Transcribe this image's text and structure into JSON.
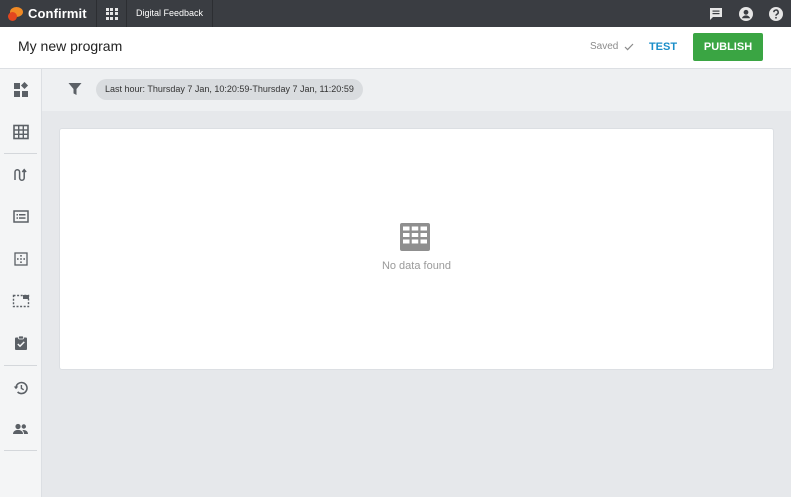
{
  "topbar": {
    "brand": "Confirmit",
    "product": "Digital Feedback"
  },
  "header": {
    "title": "My new program",
    "saved_status": "Saved",
    "test_label": "TEST",
    "publish_label": "PUBLISH"
  },
  "filter": {
    "chip_label": "Last hour: Thursday 7 Jan, 10:20:59-Thursday 7 Jan, 11:20:59"
  },
  "main": {
    "empty_message": "No data found"
  },
  "colors": {
    "topbar_bg": "#3a3d42",
    "accent_blue": "#1a8ec9",
    "publish_green": "#3aa543",
    "icon_gray": "#5b6066"
  },
  "sidebar": {
    "icons": [
      "dashboard-icon",
      "table-icon",
      "flow-icon",
      "list-icon",
      "target-icon",
      "selection-icon",
      "clipboard-check-icon",
      "history-icon",
      "users-icon"
    ]
  },
  "topbar_icons": [
    "chat-icon",
    "account-icon",
    "help-icon"
  ]
}
